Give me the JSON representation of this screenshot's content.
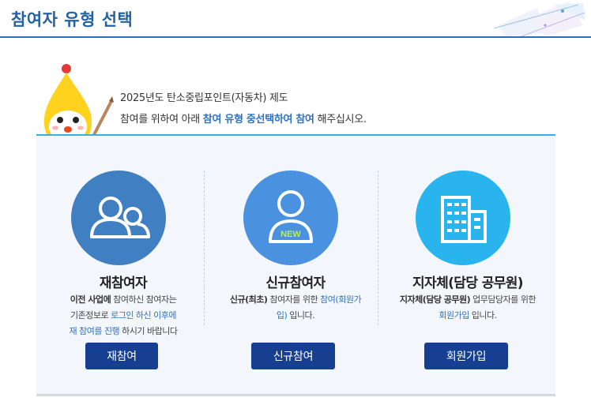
{
  "header": {
    "title": "참여자 유형 선택"
  },
  "intro": {
    "line1": "2025년도 탄소중립포인트(자동차) 제도",
    "line2_pre": "참여를 위하여 아래 ",
    "line2_highlight": "참여 유형 중선택하여 참여",
    "line2_post": " 해주십시오."
  },
  "cards": [
    {
      "title": "재참여자",
      "desc": [
        [
          {
            "t": "이전 사업에",
            "s": "b"
          },
          {
            "t": " 참여하신 참여자는",
            "s": ""
          }
        ],
        [
          {
            "t": "기존정보로 ",
            "s": ""
          },
          {
            "t": "로그인 하신 이후에",
            "s": "blue"
          }
        ],
        [
          {
            "t": "재 참여를 진행",
            "s": "blue"
          },
          {
            "t": " 하시기 바랍니다",
            "s": ""
          }
        ]
      ],
      "button": "재참여",
      "icon": "group-users-icon",
      "color": "#3f7fc2"
    },
    {
      "title": "신규참여자",
      "desc": [
        [
          {
            "t": "신규(최초)",
            "s": "b"
          },
          {
            "t": " 참여자를 위한 ",
            "s": ""
          },
          {
            "t": "참여(회원가",
            "s": "blue"
          }
        ],
        [
          {
            "t": "입)",
            "s": "blue"
          },
          {
            "t": " 입니다.",
            "s": ""
          }
        ]
      ],
      "button": "신규참여",
      "icon": "new-user-icon",
      "badge": "NEW",
      "color": "#4a92df"
    },
    {
      "title": "지자체(담당 공무원)",
      "desc": [
        [
          {
            "t": "지자체(담당 공무원)",
            "s": "b"
          },
          {
            "t": " 업무담당자를 위한",
            "s": ""
          }
        ],
        [
          {
            "t": "회원가입",
            "s": "blue"
          },
          {
            "t": " 입니다.",
            "s": ""
          }
        ]
      ],
      "button": "회원가입",
      "icon": "building-icon",
      "color": "#29b4ee"
    }
  ]
}
